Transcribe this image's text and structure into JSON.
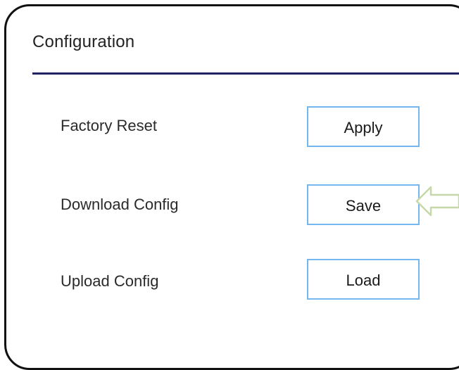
{
  "panel": {
    "title": "Configuration",
    "accent_color": "#1f2360",
    "button_border_color": "#74b6ee"
  },
  "rows": [
    {
      "label": "Factory Reset",
      "button": "Apply"
    },
    {
      "label": "Download Config",
      "button": "Save"
    },
    {
      "label": "Upload Config",
      "button": "Load"
    }
  ],
  "annotation": {
    "icon": "left-arrow-icon",
    "target": "Save",
    "color": "#c6d8a8"
  }
}
